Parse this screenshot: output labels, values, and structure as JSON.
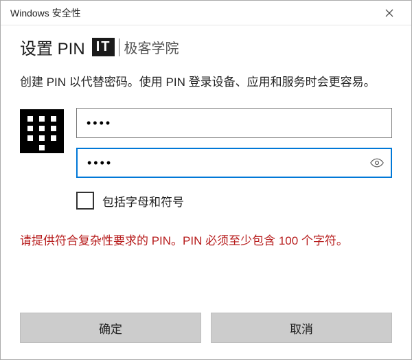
{
  "titlebar": {
    "title": "Windows 安全性"
  },
  "heading": "设置 PIN",
  "logo": {
    "badge": "IT",
    "text": "极客学院"
  },
  "description": "创建 PIN 以代替密码。使用 PIN 登录设备、应用和服务时会更容易。",
  "fields": {
    "pin_value": "••••",
    "confirm_value": "••••"
  },
  "checkbox": {
    "label": "包括字母和符号",
    "checked": false
  },
  "error": "请提供符合复杂性要求的 PIN。PIN 必须至少包含 100 个字符。",
  "buttons": {
    "ok": "确定",
    "cancel": "取消"
  },
  "icons": {
    "close": "close-icon",
    "keypad": "keypad-icon",
    "reveal": "eye-icon"
  }
}
